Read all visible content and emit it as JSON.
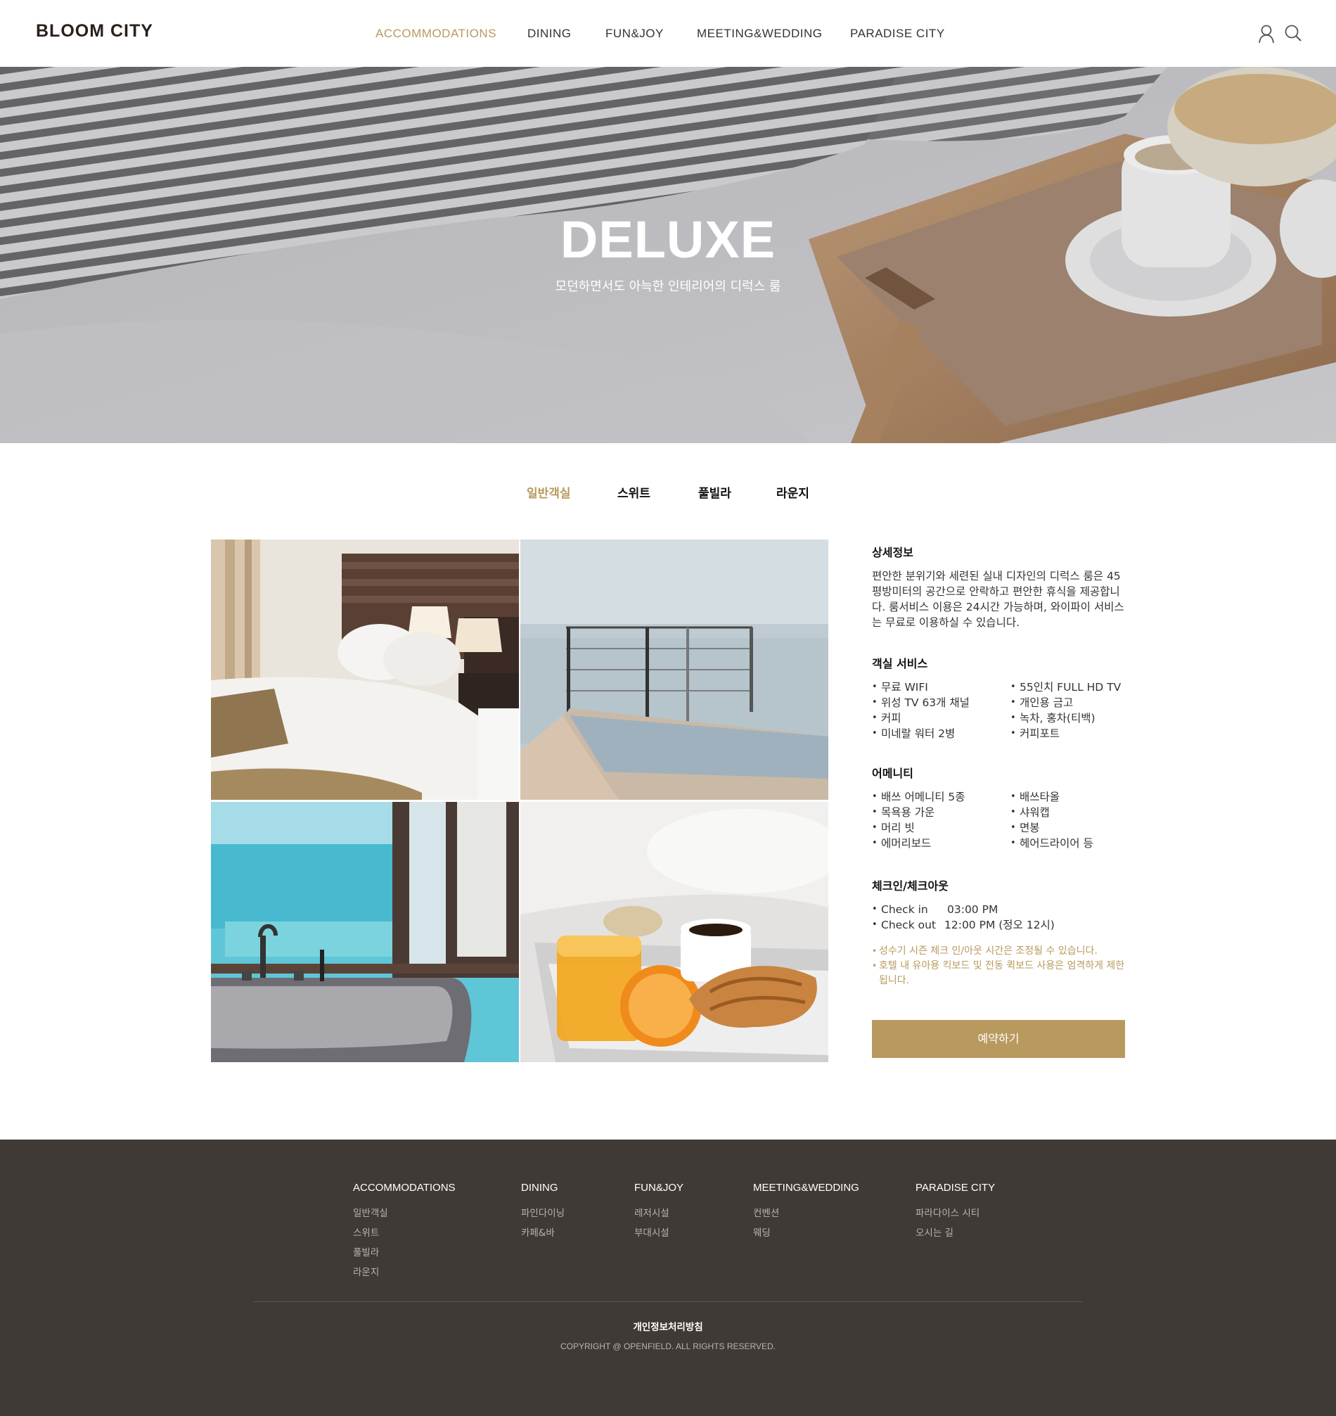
{
  "header": {
    "logo": "BLOOM CITY",
    "nav": [
      {
        "label": "ACCOMMODATIONS",
        "active": true
      },
      {
        "label": "DINING"
      },
      {
        "label": "FUN&JOY"
      },
      {
        "label": "MEETING&WEDDING"
      },
      {
        "label": "PARADISE CITY"
      }
    ],
    "icons": [
      "user-icon",
      "search-icon"
    ]
  },
  "hero": {
    "title": "DELUXE",
    "subtitle": "모던하면서도 아늑한 인테리어의 디럭스 룸"
  },
  "tabs": [
    {
      "label": "일반객실",
      "active": true
    },
    {
      "label": "스위트"
    },
    {
      "label": "풀빌라"
    },
    {
      "label": "라운지"
    }
  ],
  "details": {
    "title": "상세정보",
    "description": "편안한 분위기와 세련된 실내 디자인의 디럭스 룸은 45평방미터의 공간으로 안락하고 편안한 휴식을 제공합니다. 룸서비스 이용은 24시간 가능하며, 와이파이 서비스는 무료로 이용하실 수 있습니다."
  },
  "room_service": {
    "title": "객실 서비스",
    "left": [
      "무료 WIFI",
      "위성 TV 63개 채널",
      "커피",
      "미네랄 워터 2병"
    ],
    "right": [
      "55인치 FULL HD TV",
      "개인용 금고",
      "녹차, 홍차(티백)",
      "커피포트"
    ]
  },
  "amenity": {
    "title": "어메니티",
    "left": [
      "배쓰 어메니티 5종",
      "목욕용 가운",
      "머리 빗",
      "에머리보드"
    ],
    "right": [
      "배쓰타올",
      "샤워캡",
      "면봉",
      "헤어드라이어 등"
    ]
  },
  "checkin": {
    "title": "체크인/체크아웃",
    "items": [
      {
        "label": "Check in",
        "value": "03:00 PM"
      },
      {
        "label": "Check out",
        "value": "12:00 PM (정오 12시)"
      }
    ],
    "notes": [
      "성수기 시즌 체크 인/아웃 시간은 조정될 수 있습니다.",
      "호텔 내 유아용 킥보드 및 전동 퀵보드 사용은 엄격하게 제한됩니다."
    ]
  },
  "reserve_label": "예약하기",
  "footer": {
    "columns": [
      {
        "heading": "ACCOMMODATIONS",
        "links": [
          "일반객실",
          "스위트",
          "풀빌라",
          "라운지"
        ]
      },
      {
        "heading": "DINING",
        "links": [
          "파인다이닝",
          "카페&바"
        ]
      },
      {
        "heading": "FUN&JOY",
        "links": [
          "레저시설",
          "부대시설"
        ]
      },
      {
        "heading": "MEETING&WEDDING",
        "links": [
          "컨벤션",
          "웨딩"
        ]
      },
      {
        "heading": "PARADISE CITY",
        "links": [
          "파라다이스 시티",
          "오시는 길"
        ]
      }
    ],
    "privacy": "개인정보처리방침",
    "copyright": "COPYRIGHT @ OPENFIELD. ALL RIGHTS RESERVED."
  },
  "colors": {
    "accent": "#b89a5e",
    "footer_bg": "#403a36",
    "text": "#222222"
  }
}
